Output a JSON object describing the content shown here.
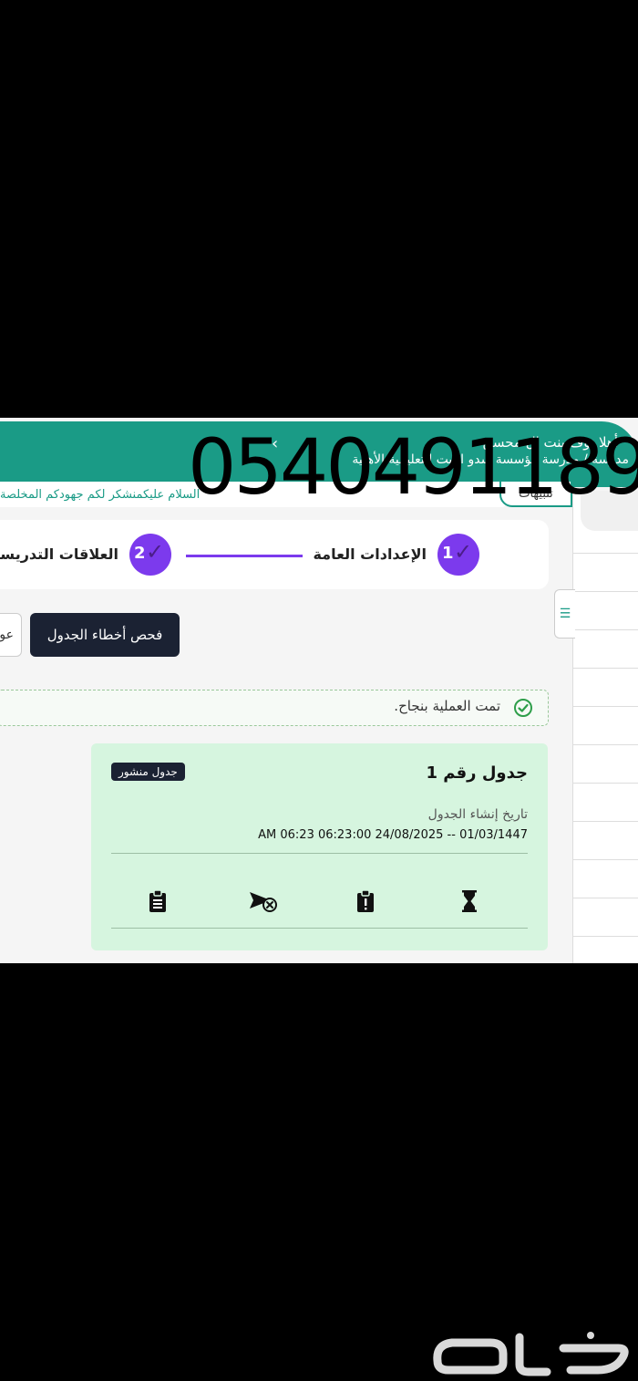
{
  "header": {
    "greeting": "أهلا نوف بنت ال محسن",
    "school": "مدرسة / مدرسة مؤسسة سدو البيت التعليمية الأهلية"
  },
  "ticker": {
    "text": "السلام عليكمنشكر لكم جهودكم المخلصة"
  },
  "alerts_tab": {
    "label": "تنبيهات"
  },
  "stepper": {
    "steps": [
      {
        "number": "1",
        "label": "الإعدادات العامة"
      },
      {
        "number": "2",
        "label": "العلاقات التدريسية"
      }
    ]
  },
  "buttons": {
    "check_errors": "فحص أخطاء الجدول",
    "partial": "عو"
  },
  "status": {
    "message": "تمت العملية بنجاح."
  },
  "schedule_card": {
    "title": "جدول رقم 1",
    "badge": "جدول منشور",
    "created_label": "تاريخ إنشاء الجدول",
    "created_value": "AM 06:23 06:23:00 24/08/2025 -- 01/03/1447",
    "actions": [
      "clipboard-icon",
      "send-cancel-icon",
      "alert-clipboard-icon",
      "hourglass-icon"
    ]
  },
  "watermark": {
    "phone": "0540491189",
    "logo": "حراج"
  },
  "colors": {
    "teal": "#1a9b86",
    "purple": "#7c3aed",
    "dark": "#1b2233",
    "card_green": "#d6f5df"
  }
}
